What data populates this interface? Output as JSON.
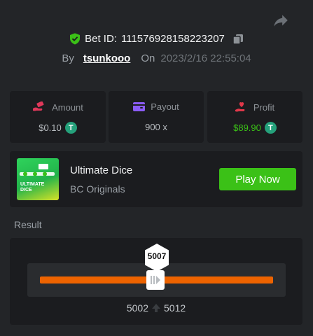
{
  "header": {
    "bet_label": "Bet ID:",
    "bet_id": "111576928158223207",
    "by_label": "By",
    "username": "tsunkooo",
    "on_label": "On",
    "date": "2023/2/16 22:55:04"
  },
  "stats": {
    "amount": {
      "label": "Amount",
      "value": "$0.10",
      "icon": "hand-coins-icon",
      "color": "#e0385a"
    },
    "payout": {
      "label": "Payout",
      "value": "900 x",
      "icon": "wallet-icon",
      "color": "#8b5cf6"
    },
    "profit": {
      "label": "Profit",
      "value": "$89.90",
      "icon": "hand-heart-icon",
      "color": "#e0384a"
    },
    "currency_glyph": "T"
  },
  "game": {
    "title": "Ultimate Dice",
    "subtitle": "BC Originals",
    "play_label": "Play Now",
    "thumbnail_text_line1": "ULTIMATE",
    "thumbnail_text_line2": "DICE"
  },
  "result": {
    "label": "Result",
    "value": "5007",
    "range_low": "5002",
    "range_high": "5012",
    "bar_color": "#ed6300"
  },
  "colors": {
    "accent_green": "#3bc117",
    "background": "#232528",
    "card": "#1b1c1f"
  }
}
